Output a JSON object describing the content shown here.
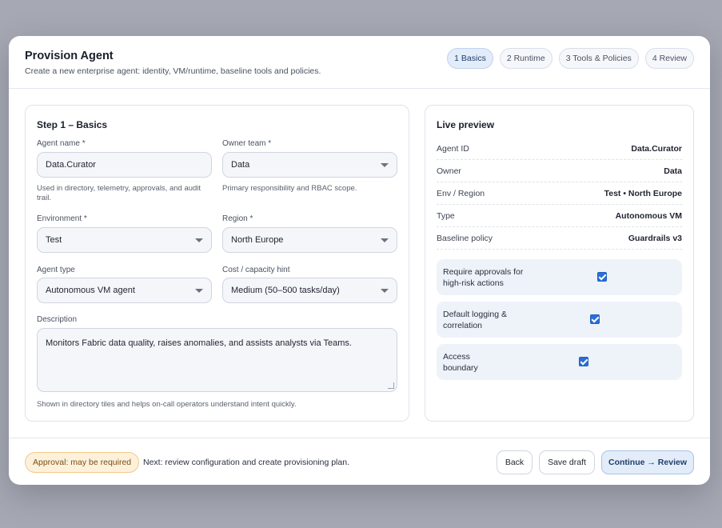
{
  "header": {
    "title": "Provision Agent",
    "subtitle": "Create a new enterprise agent: identity, VM/runtime, baseline tools and policies.",
    "steps": [
      {
        "label": "1 Basics"
      },
      {
        "label": "2 Runtime"
      },
      {
        "label": "3 Tools & Policies"
      },
      {
        "label": "4 Review"
      }
    ]
  },
  "form": {
    "title": "Step 1 – Basics",
    "agent_name": {
      "label": "Agent name *",
      "value": "Data.Curator",
      "help": "Used in directory, telemetry, approvals, and audit trail."
    },
    "owner_team": {
      "label": "Owner team *",
      "value": "Data",
      "help": "Primary responsibility and RBAC scope."
    },
    "environment": {
      "label": "Environment *",
      "value": "Test"
    },
    "region": {
      "label": "Region *",
      "value": "North Europe"
    },
    "agent_type": {
      "label": "Agent type",
      "value": "Autonomous VM agent"
    },
    "cost_hint": {
      "label": "Cost / capacity hint",
      "value": "Medium (50–500 tasks/day)"
    },
    "description": {
      "label": "Description",
      "value": "Monitors Fabric data quality, raises anomalies, and assists analysts via Teams.",
      "help": "Shown in directory tiles and helps on-call operators understand intent quickly."
    }
  },
  "preview": {
    "title": "Live preview",
    "rows": [
      {
        "key": "Agent ID",
        "value": "Data.Curator"
      },
      {
        "key": "Owner",
        "value": "Data"
      },
      {
        "key": "Env / Region",
        "value": "Test • North Europe"
      },
      {
        "key": "Type",
        "value": "Autonomous VM"
      },
      {
        "key": "Baseline policy",
        "value": "Guardrails v3"
      }
    ],
    "toggles": [
      {
        "label_line1": "Require approvals for",
        "label_line2": "high-risk actions",
        "checked": true
      },
      {
        "label_line1": "Default logging &",
        "label_line2": "correlation",
        "checked": true
      },
      {
        "label_line1": "Access",
        "label_line2": "boundary",
        "checked": true
      }
    ]
  },
  "footer": {
    "badge": "Approval: may be required",
    "note": "Next: review configuration and create provisioning plan.",
    "back": "Back",
    "save_draft": "Save draft",
    "continue": "Continue → Review"
  }
}
